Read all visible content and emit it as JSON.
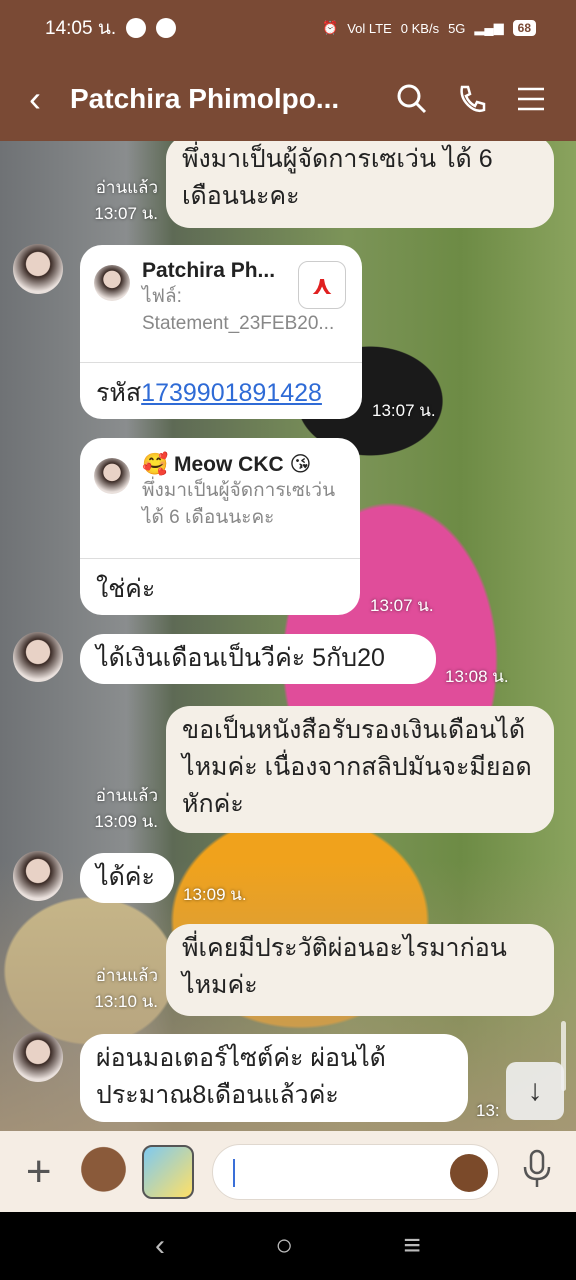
{
  "status": {
    "time": "14:05 น.",
    "network": "5G",
    "battery": "68",
    "lte": "Vol LTE",
    "speed": "0 KB/s"
  },
  "header": {
    "title": "Patchira Phimolpo..."
  },
  "messages": {
    "m1": {
      "text": "พึ่งมาเป็นผู้จัดการเซเว่น ได้ 6 เดือนนะคะ",
      "read": "อ่านแล้ว",
      "time": "13:07 น."
    },
    "m2": {
      "file_sender": "Patchira Ph...",
      "file_name": "ไฟล์: Statement_23FEB20...",
      "code_prefix": "รหัส",
      "code": "1739901891428",
      "time": "13:07 น."
    },
    "m3": {
      "reply_name": "Meow CKC",
      "reply_text": "พึ่งมาเป็นผู้จัดการเซเว่น ได้ 6 เดือนนะคะ",
      "text": "ใช่ค่ะ",
      "time": "13:07 น."
    },
    "m4": {
      "text": "ได้เงินเดือนเป็นวีค่ะ 5กับ20",
      "time": "13:08 น."
    },
    "m5": {
      "text": "ขอเป็นหนังสือรับรองเงินเดือนได้ไหมค่ะ เนื่องจากสลิปมันจะมียอดหักค่ะ",
      "read": "อ่านแล้ว",
      "time": "13:09 น."
    },
    "m6": {
      "text": "ได้ค่ะ",
      "time": "13:09 น."
    },
    "m7": {
      "text": "พี่เคยมีประวัติผ่อนอะไรมาก่อนไหมค่ะ",
      "read": "อ่านแล้ว",
      "time": "13:10 น."
    },
    "m8": {
      "text": "ผ่อนมอเตอร์ไซต์ค่ะ ผ่อนได้ประมาณ8เดือนแล้วค่ะ",
      "time": "13:"
    }
  },
  "colors": {
    "brand": "#7a4a35",
    "input_bar": "#f5ede4",
    "link": "#2f6bd6"
  }
}
